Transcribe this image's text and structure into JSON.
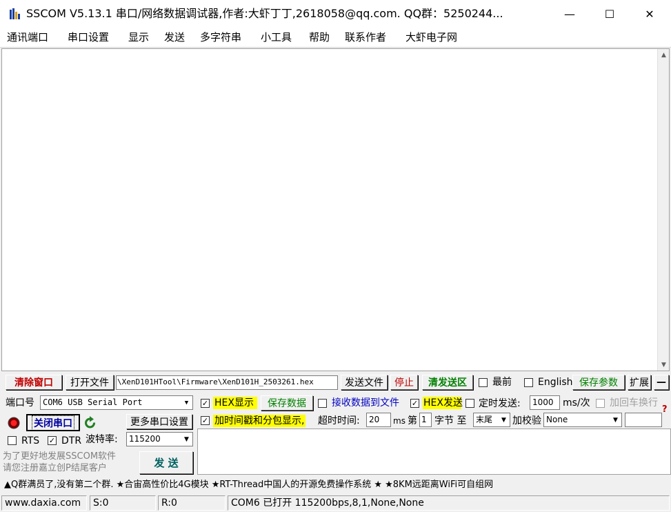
{
  "window": {
    "title": "SSCOM V5.13.1 串口/网络数据调试器,作者:大虾丁丁,2618058@qq.com. QQ群：5250244...",
    "minimize": "—",
    "maximize": "☐",
    "close": "✕"
  },
  "menu": [
    "通讯端口",
    "串口设置",
    "显示",
    "发送",
    "多字符串",
    "小工具",
    "帮助",
    "联系作者",
    "大虾电子网"
  ],
  "toolbar": {
    "clear_window": "清除窗口",
    "open_file": "打开文件",
    "file_path": "\\XenD101HTool\\Firmware\\XenD101H_2503261.hex",
    "send_file": "发送文件",
    "stop": "停止",
    "clear_send_area": "清发送区",
    "topmost_label": "最前",
    "english_label": "English",
    "save_params": "保存参数",
    "expand": "扩展",
    "collapse": "—"
  },
  "port": {
    "port_label": "端口号",
    "port_value": "COM6 USB Serial Port",
    "close_port": "关闭串口",
    "more_settings": "更多串口设置",
    "rts_label": "RTS",
    "dtr_label": "DTR",
    "baud_label": "波特率:",
    "baud_value": "115200",
    "promo_text_1": "为了更好地发展SSCOM软件",
    "promo_text_2": "请您注册嘉立创P结尾客户",
    "send": "发  送"
  },
  "options": {
    "hex_display": "HEX显示",
    "save_data": "保存数据",
    "recv_to_file": "接收数据到文件",
    "hex_send": "HEX发送",
    "timed_send": "定时发送:",
    "interval_value": "1000",
    "interval_unit": "ms/次",
    "add_crlf": "加回车换行",
    "timestamp": "加时间戳和分包显示,",
    "timeout_label": "超时时间:",
    "timeout_value": "20",
    "timeout_unit": "ms",
    "byte_prefix": "第",
    "byte_value": "1",
    "byte_suffix": "字节 至",
    "end_value": "末尾",
    "checksum_label": "加校验",
    "checksum_value": "None",
    "help_mark": "?"
  },
  "promo_bar": "▲Q群满员了,没有第二个群. ★合宙高性价比4G模块 ★RT-Thread中国人的开源免费操作系统 ★ ★8KM远距离WiFi可自组网",
  "status": {
    "site": "www.daxia.com",
    "sent": "S:0",
    "received": "R:0",
    "port_status": "COM6 已打开  115200bps,8,1,None,None"
  }
}
